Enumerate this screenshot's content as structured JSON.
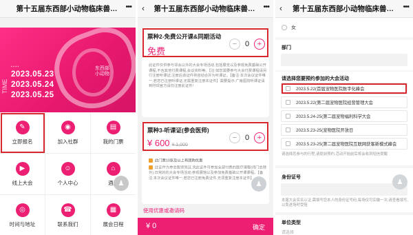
{
  "app": {
    "title": "第十五届东西部小动物临床兽医师..."
  },
  "panel1": {
    "banner": {
      "dates": [
        "2023.05.23",
        "2023.05.24",
        "2023.05.25"
      ],
      "brand_text": "东西部\n小动物",
      "side_text": "TIME"
    },
    "menu": [
      {
        "label": "立即报名",
        "icon": "register-icon",
        "glyph": "✎",
        "highlighted": true
      },
      {
        "label": "加入社群",
        "icon": "community-icon",
        "glyph": "◉",
        "highlighted": false
      },
      {
        "label": "我的门票",
        "icon": "ticket-icon",
        "glyph": "▤",
        "highlighted": false
      },
      {
        "label": "线上大会",
        "icon": "online-icon",
        "glyph": "▶",
        "highlighted": false
      },
      {
        "label": "个人中心",
        "icon": "user-icon",
        "glyph": "☺",
        "highlighted": false
      },
      {
        "label": "酒店",
        "icon": "hotel-icon",
        "glyph": "⌂",
        "highlighted": false
      },
      {
        "label": "时间与地址",
        "icon": "location-icon",
        "glyph": "◎",
        "highlighted": false
      },
      {
        "label": "联系我们",
        "icon": "phone-icon",
        "glyph": "☎",
        "highlighted": false
      },
      {
        "label": "展会日程",
        "icon": "calendar-icon",
        "glyph": "▦",
        "highlighted": false
      }
    ]
  },
  "panel2": {
    "ticket1": {
      "name": "票种2-免费公开课&同期活动",
      "price": "免费",
      "quantity": "0",
      "note": "此证件仅供参与邻会以外的大会专场活动,包括展览以及参观免费基础公开课程,不含其他付费课程,会议资料等。【注:如您需要参与大会付费课程请另行注册听课证,注册后该证件将自动合并为听课证。【备注:本次会议证件唯一,若您已注册听课证,无需重复注册本证件】需要提示:广南医院听课证请到时现官方请勿注册此证件!"
    },
    "ticket2": {
      "name": "票种3-听课证(参会医师)",
      "price": "¥ 600",
      "original_price": "¥ 1,000",
      "quantity": "0",
      "badge": "此门票10张及以上有团购优惠",
      "note": "此证件为参会医师凭证,凭此证件可参加全部付费的医疗课程(闭门会除外),日常的的大会专场活动,参观展馆以及参加免费基础公开课课程。【备注:本次会议证件唯一,若您已注册免费证件,无须重复注册本证件】"
    },
    "coupon_link": "使用优惠或邀请码",
    "total": "¥ 0",
    "confirm": "确定"
  },
  "panel3": {
    "gender_option": "女",
    "dept_label": "部门",
    "events_label": "请选择您要预约参加的大会活动",
    "events": [
      {
        "label": "2023.5.22(首届宠物医院数字化峰会",
        "highlighted": true
      },
      {
        "label": "2023.5.22(第二届宠物医院经营管理大会",
        "highlighted": false
      },
      {
        "label": "2023.5.24-25(第二届宠物福利科学大会",
        "highlighted": false
      },
      {
        "label": "2023.5.23-25(宠物医院开放日",
        "highlighted": false
      },
      {
        "label": "2023.5.23-25(第二届宠物医院互联网获客新模式峰会",
        "highlighted": false
      }
    ],
    "events_hint": "请选择您参与的行程,请提前预约,活动开始前后将会收到短信提醒",
    "id_label": "身份证号",
    "id_hint": "本届大会实名认证,需填写您本人的身份证号码,每场仅可实缴一次,请查看填写,以免进场时受阻",
    "unit_label": "单位类型",
    "unit_placeholder": "请选择"
  },
  "colors": {
    "brand": "#ec1f73",
    "highlight": "#d9252d"
  }
}
